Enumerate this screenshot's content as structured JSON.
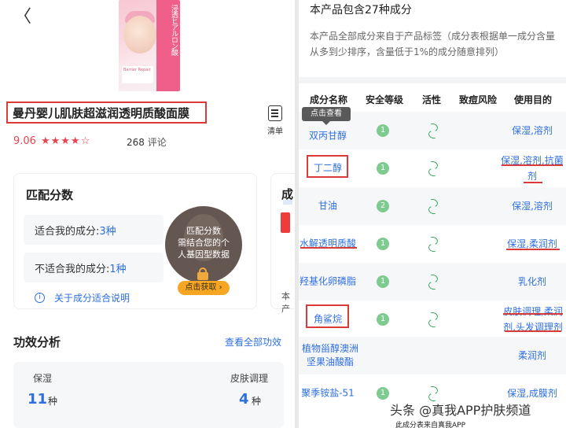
{
  "left": {
    "product_name": "曼丹婴儿肌肤超滋润透明质酸面膜",
    "list_label": "清单",
    "score": "9.06",
    "stars": "★★★★☆",
    "review_count": "268",
    "review_label": "评论",
    "image_band_text": "浸透ヒアルロン酸",
    "image_label_text": "Barrier Repair",
    "match": {
      "title": "匹配分数",
      "suitable_label": "适合我的成分:",
      "suitable_value": "3种",
      "unsuitable_label": "不适合我的成分:",
      "unsuitable_value": "1种",
      "about": "关于成分适合说明",
      "overlay_text_1": "匹配分数",
      "overlay_text_2": "需结合您的个",
      "overlay_text_3": "人基因型数据",
      "unlock_button": "点击获取 ›"
    },
    "peek": {
      "title": "成",
      "sub": "本产"
    },
    "effect": {
      "title": "功效分析",
      "view_all": "查看全部功效",
      "items": [
        {
          "name": "保湿",
          "value": "11",
          "unit": "种"
        },
        {
          "name": "皮肤调理",
          "value": "4",
          "unit": "种"
        }
      ]
    }
  },
  "right": {
    "title": "本产品包含27种成分",
    "desc": "本产品全部成分来自于产品标签（成分表根据单一成分含量从多到少排序，含量低于1%的成分随意排列）",
    "headers": [
      "成分名称",
      "安全等级",
      "活性",
      "致痘风险",
      "使用目的"
    ],
    "tooltip": "点击查看",
    "rows": [
      {
        "name": "双丙甘醇",
        "safety": "1",
        "active": true,
        "use": "保湿,溶剂"
      },
      {
        "name": "丁二醇",
        "safety": "1",
        "active": true,
        "use": "保湿,溶剂,抗菌剂"
      },
      {
        "name": "甘油",
        "safety": "2",
        "active": true,
        "use": "保湿,溶剂"
      },
      {
        "name": "水解透明质酸",
        "safety": "1",
        "active": true,
        "use": "保湿,柔润剂"
      },
      {
        "name": "羟基化卵磷脂",
        "safety": "1",
        "active": true,
        "use": "乳化剂"
      },
      {
        "name": "角鲨烷",
        "safety": "1",
        "active": true,
        "use": "皮肤调理,柔润剂,头发调理剂"
      },
      {
        "name": "植物甾醇澳洲坚果油酸酯",
        "safety": "1",
        "active": false,
        "use": "柔润剂"
      },
      {
        "name": "聚季铵盐-51",
        "safety": "1",
        "active": true,
        "use": "保湿,成膜剂"
      }
    ],
    "watermark": "头条 @真我APP护肤频道",
    "caption": "此成分表来自真我APP"
  },
  "colors": {
    "accent": "#2e6fe0",
    "alert": "#d93a3a",
    "star": "#e8434f",
    "safety_green": "#7ecb8f",
    "active_green": "#2fa65a"
  },
  "icons": {
    "back": "chevron-left-icon",
    "list": "list-icon",
    "info": "info-icon",
    "lock": "lock-icon",
    "active": "dna-icon"
  }
}
